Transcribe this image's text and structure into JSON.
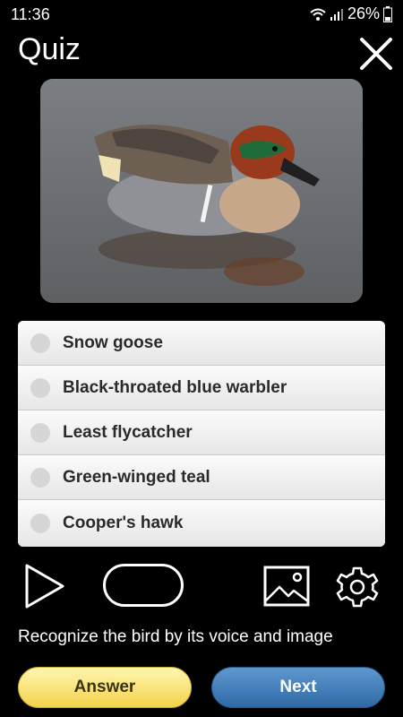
{
  "status_bar": {
    "time": "11:36",
    "battery": "26%",
    "icons": [
      "wifi-icon",
      "signal-icon",
      "battery-icon"
    ]
  },
  "header": {
    "title": "Quiz",
    "close_icon": "close-icon"
  },
  "photo": {
    "subject": "duck-photo"
  },
  "options": [
    {
      "label": "Snow goose"
    },
    {
      "label": "Black-throated blue warbler"
    },
    {
      "label": "Least flycatcher"
    },
    {
      "label": "Green-winged teal"
    },
    {
      "label": "Cooper's hawk"
    }
  ],
  "controls": {
    "icons": [
      "play-icon",
      "pill-toggle",
      "image-icon",
      "gear-icon"
    ]
  },
  "instruction": "Recognize the bird by its voice and image",
  "buttons": {
    "answer": "Answer",
    "next": "Next"
  },
  "colors": {
    "background": "#000000",
    "answer_button": "#f3d34a",
    "next_button": "#3a78b8"
  }
}
